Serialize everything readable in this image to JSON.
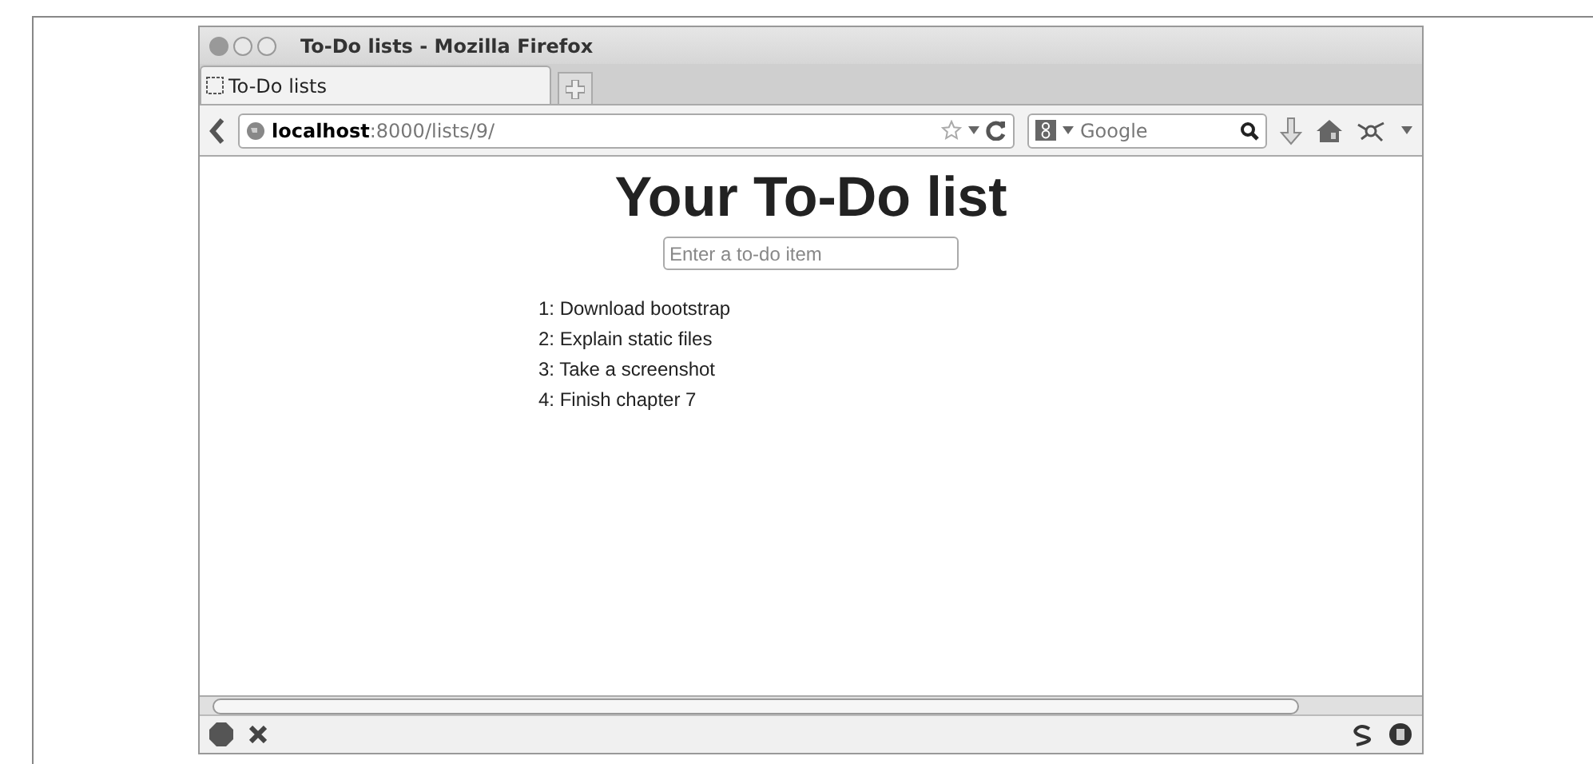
{
  "window": {
    "title": "To-Do lists - Mozilla Firefox"
  },
  "tabs": [
    {
      "label": "To-Do lists",
      "selected": true
    }
  ],
  "address_bar": {
    "host": "localhost",
    "path": ":8000/lists/9/"
  },
  "search": {
    "placeholder": "Google"
  },
  "page": {
    "heading": "Your To-Do list",
    "new_item": {
      "placeholder": "Enter a to-do item"
    },
    "items": [
      "1: Download bootstrap",
      "2: Explain static files",
      "3: Take a screenshot",
      "4: Finish chapter 7"
    ]
  }
}
